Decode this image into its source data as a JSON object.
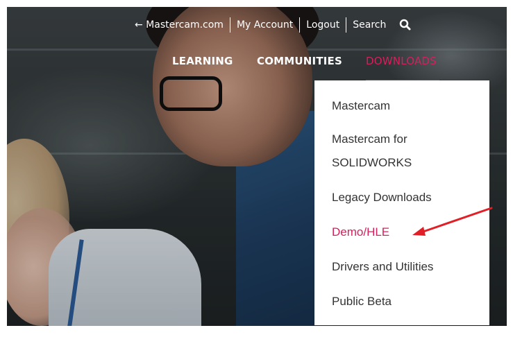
{
  "top_nav": {
    "back_link": "← Mastercam.com",
    "my_account": "My Account",
    "logout": "Logout",
    "search": "Search",
    "search_icon": "search-icon"
  },
  "main_nav": {
    "learning": "LEARNING",
    "communities": "COMMUNITIES",
    "downloads": "DOWNLOADS",
    "active_color": "#d81e5b"
  },
  "dropdown": {
    "items": [
      {
        "label": "Mastercam"
      },
      {
        "label": "Mastercam for"
      },
      {
        "label": "SOLIDWORKS"
      },
      {
        "label": "Legacy Downloads"
      },
      {
        "label": "Demo/HLE",
        "active": true
      },
      {
        "label": "Drivers and Utilities"
      },
      {
        "label": "Public Beta"
      }
    ],
    "text_color": "#333333",
    "active_color": "#d81e5b"
  },
  "annotation": {
    "type": "red-arrow",
    "color": "#e11f26",
    "points_to": "Demo/HLE"
  }
}
